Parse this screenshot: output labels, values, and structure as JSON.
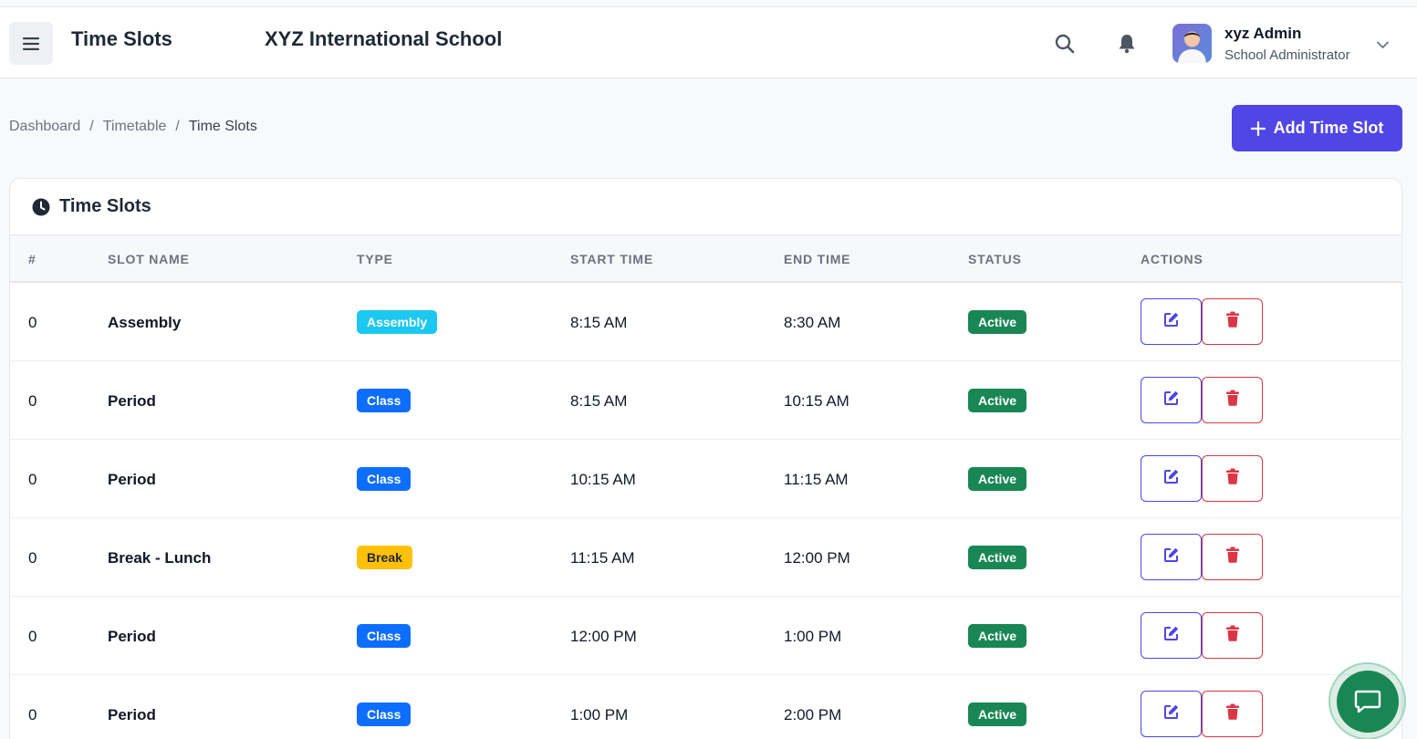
{
  "header": {
    "page_title": "Time Slots",
    "school_name": "XYZ International School",
    "user_name": "xyz Admin",
    "user_role": "School Administrator"
  },
  "breadcrumb": [
    "Dashboard",
    "Timetable",
    "Time Slots"
  ],
  "add_button_label": "Add Time Slot",
  "card_title": "Time Slots",
  "table": {
    "columns": [
      "#",
      "SLOT NAME",
      "TYPE",
      "START TIME",
      "END TIME",
      "STATUS",
      "ACTIONS"
    ],
    "rows": [
      {
        "num": "0",
        "name": "Assembly",
        "type": "Assembly",
        "type_kind": "assembly",
        "start": "8:15 AM",
        "end": "8:30 AM",
        "status": "Active"
      },
      {
        "num": "0",
        "name": "Period",
        "type": "Class",
        "type_kind": "class",
        "start": "8:15 AM",
        "end": "10:15 AM",
        "status": "Active"
      },
      {
        "num": "0",
        "name": "Period",
        "type": "Class",
        "type_kind": "class",
        "start": "10:15 AM",
        "end": "11:15 AM",
        "status": "Active"
      },
      {
        "num": "0",
        "name": "Break - Lunch",
        "type": "Break",
        "type_kind": "break",
        "start": "11:15 AM",
        "end": "12:00 PM",
        "status": "Active"
      },
      {
        "num": "0",
        "name": "Period",
        "type": "Class",
        "type_kind": "class",
        "start": "12:00 PM",
        "end": "1:00 PM",
        "status": "Active"
      },
      {
        "num": "0",
        "name": "Period",
        "type": "Class",
        "type_kind": "class",
        "start": "1:00 PM",
        "end": "2:00 PM",
        "status": "Active"
      }
    ]
  },
  "colors": {
    "primary": "#4f46e5",
    "danger": "#dc3545",
    "success": "#198754",
    "info": "#1cc8ef",
    "class_blue": "#0d6efd",
    "warning": "#ffc107"
  },
  "icons": [
    "menu-icon",
    "search-icon",
    "bell-icon",
    "chevron-down-icon",
    "plus-icon",
    "clock-icon",
    "edit-icon",
    "trash-icon",
    "chat-icon"
  ]
}
